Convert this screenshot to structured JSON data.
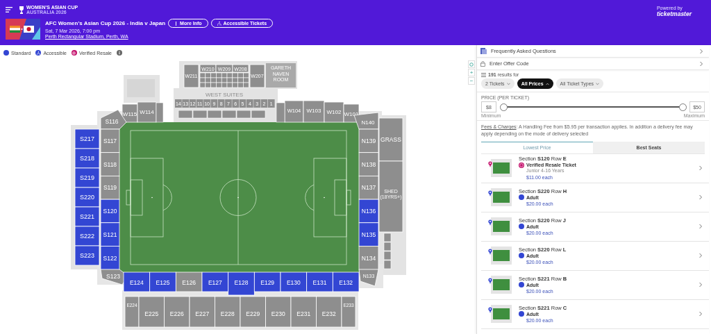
{
  "header": {
    "logo": {
      "line1": "WOMEN'S ASIAN CUP",
      "line2": "AUSTRALIA 2026"
    },
    "event": {
      "title": "AFC Women's Asian Cup 2026 - India v Japan",
      "date": "Sat, 7 Mar 2026, 7:00 pm",
      "venue": "Perth Rectangular Stadium, Perth, WA",
      "buttons": [
        {
          "label": "More Info",
          "kind": "info"
        },
        {
          "label": "Accessible Tickets",
          "kind": "accessible"
        }
      ]
    },
    "powered_by": "Powered by",
    "brand": "ticketmaster"
  },
  "map": {
    "legend": [
      {
        "label": "Standard",
        "color": "#3346d3",
        "kind": "standard"
      },
      {
        "label": "Accessible",
        "color": "#3346d3",
        "kind": "accessible"
      },
      {
        "label": "Verified Resale",
        "color": "#c4136d",
        "kind": "resale"
      }
    ],
    "zoom_controls": [
      {
        "kind": "reset"
      },
      {
        "kind": "zoom_in",
        "label": "+"
      },
      {
        "kind": "zoom_out",
        "label": "−"
      }
    ],
    "west_upper": [
      {
        "label": "W211",
        "available": false
      },
      {
        "label": "W210",
        "available": false
      },
      {
        "label": "W209",
        "available": false
      },
      {
        "label": "W208",
        "available": false
      },
      {
        "label": "W207",
        "available": false
      }
    ],
    "room": "GARETH NAVEN ROOM",
    "west_suites": {
      "title": "WEST SUITES",
      "boxes": [
        "14",
        "13",
        "12",
        "11",
        "10",
        "9",
        "8",
        "7",
        "6",
        "5",
        "4",
        "3",
        "2",
        "1"
      ]
    },
    "west_lower": [
      {
        "label": "W115",
        "available": false
      },
      {
        "label": "W114",
        "available": false
      },
      {
        "label": "W104",
        "available": false
      },
      {
        "label": "W103",
        "available": false
      },
      {
        "label": "W102",
        "available": false
      },
      {
        "label": "W101",
        "available": false
      }
    ],
    "south_lower": [
      {
        "label": "S116",
        "available": false
      },
      {
        "label": "S117",
        "available": false
      },
      {
        "label": "S118",
        "available": false
      },
      {
        "label": "S119",
        "available": false
      },
      {
        "label": "S120",
        "available": true
      },
      {
        "label": "S121",
        "available": true
      },
      {
        "label": "S122",
        "available": true
      },
      {
        "label": "S123",
        "available": false
      }
    ],
    "south_upper": [
      {
        "label": "S217",
        "available": true
      },
      {
        "label": "S218",
        "available": true
      },
      {
        "label": "S219",
        "available": true
      },
      {
        "label": "S220",
        "available": true
      },
      {
        "label": "S221",
        "available": true
      },
      {
        "label": "S222",
        "available": true
      },
      {
        "label": "S223",
        "available": true
      }
    ],
    "north_lower": [
      {
        "label": "N140",
        "available": false
      },
      {
        "label": "N139",
        "available": false
      },
      {
        "label": "N138",
        "available": false
      },
      {
        "label": "N137",
        "available": false
      },
      {
        "label": "N136",
        "available": true
      },
      {
        "label": "N135",
        "available": true
      },
      {
        "label": "N134",
        "available": false
      },
      {
        "label": "N133",
        "available": false
      }
    ],
    "north_terraces": [
      {
        "label": "GRASS",
        "available": false
      },
      {
        "label": "SHED (18YRS+)",
        "available": false
      }
    ],
    "east_lower": [
      {
        "label": "E124",
        "available": true
      },
      {
        "label": "E125",
        "available": true
      },
      {
        "label": "E126",
        "available": false
      },
      {
        "label": "E127",
        "available": true
      },
      {
        "label": "E128",
        "available": true
      },
      {
        "label": "E129",
        "available": true
      },
      {
        "label": "E130",
        "available": true
      },
      {
        "label": "E131",
        "available": true
      },
      {
        "label": "E132",
        "available": true
      }
    ],
    "east_upper": [
      {
        "label": "E224",
        "available": false
      },
      {
        "label": "E225",
        "available": false
      },
      {
        "label": "E226",
        "available": false
      },
      {
        "label": "E227",
        "available": false
      },
      {
        "label": "E228",
        "available": false
      },
      {
        "label": "E229",
        "available": false
      },
      {
        "label": "E230",
        "available": false
      },
      {
        "label": "E231",
        "available": false
      },
      {
        "label": "E232",
        "available": false
      },
      {
        "label": "E233",
        "available": false
      }
    ]
  },
  "panel": {
    "links": [
      {
        "label": "Frequently Asked Questions",
        "kind": "faq"
      },
      {
        "label": "Enter Offer Code",
        "kind": "offer"
      }
    ],
    "results": "**191** results for",
    "filters": [
      {
        "label": "2 Tickets",
        "selected": false,
        "expanded": false
      },
      {
        "label": "All Prices",
        "selected": true,
        "expanded": true
      },
      {
        "label": "All Ticket Types",
        "selected": false,
        "expanded": false
      }
    ],
    "price": {
      "title": "PRICE (PER TICKET)",
      "min": "$8",
      "max": "$50",
      "min_label": "Minimum",
      "max_label": "Maximum",
      "thumbs": [
        {
          "level": 0
        },
        {
          "level": 1
        }
      ]
    },
    "fees": {
      "link": "Fees & Charges",
      "text": ": A Handling Fee from $5.95 per transaction applies. In addition a delivery fee may apply depending on the mode of delivery selected"
    },
    "tabs": [
      {
        "label": "Lowest Price",
        "selected": true
      },
      {
        "label": "Best Seats",
        "selected": false
      }
    ],
    "listings": [
      {
        "title": "Section **S120**  Row **E**",
        "type": "Verified Resale Ticket",
        "kind": "resale",
        "color": "#c4136d",
        "note": "Junior 4-16 Years",
        "price": "$11.00 each"
      },
      {
        "title": "Section **S220**  Row **H**",
        "type": "Adult",
        "kind": "standard",
        "color": "#3346d3",
        "price": "$20.00 each"
      },
      {
        "title": "Section **S220**  Row **J**",
        "type": "Adult",
        "kind": "standard",
        "color": "#3346d3",
        "price": "$20.00 each"
      },
      {
        "title": "Section **S220**  Row **L**",
        "type": "Adult",
        "kind": "standard",
        "color": "#3346d3",
        "price": "$20.00 each"
      },
      {
        "title": "Section **S221**  Row **B**",
        "type": "Adult",
        "kind": "standard",
        "color": "#3346d3",
        "price": "$20.00 each"
      },
      {
        "title": "Section **S221**  Row **C**",
        "type": "Adult",
        "kind": "standard",
        "color": "#3346d3",
        "price": "$20.00 each"
      }
    ]
  }
}
